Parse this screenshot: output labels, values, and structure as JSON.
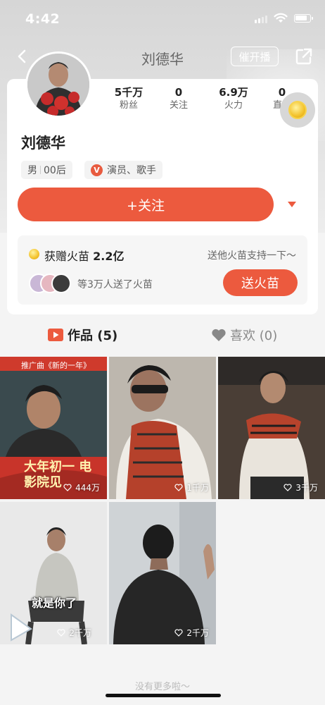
{
  "status_bar": {
    "time": "4:42"
  },
  "nav": {
    "title": "刘德华",
    "urge_label": "催开播"
  },
  "profile": {
    "name": "刘德华",
    "stats": [
      {
        "value": "5千万",
        "label": "粉丝"
      },
      {
        "value": "0",
        "label": "关注"
      },
      {
        "value": "6.9万",
        "label": "火力"
      },
      {
        "value": "0",
        "label": "直播"
      }
    ],
    "gender": "男",
    "age_group": "00后",
    "occupation": "演员、歌手",
    "verified_badge": "V",
    "follow_label": "+关注"
  },
  "gift": {
    "title_prefix": "获赠火苗",
    "amount": "2.2亿",
    "support_text": "送他火苗支持一下～",
    "fans_text": "等3万人送了火苗",
    "send_label": "送火苗"
  },
  "tabs": [
    {
      "label": "作品 (5)",
      "icon": "play-icon"
    },
    {
      "label": "喜欢 (0)",
      "icon": "heart-icon"
    }
  ],
  "videos": [
    {
      "likes": "444万",
      "overlay_title": "大年初一 电影院见",
      "poster_caption": "推广曲《新的一年》"
    },
    {
      "likes": "1千万"
    },
    {
      "likes": "3千万"
    },
    {
      "likes": "2千万",
      "caption": "就是你了"
    },
    {
      "likes": "2千万"
    }
  ],
  "footer": {
    "end_text": "没有更多啦～"
  },
  "colors": {
    "accent": "#ec5a3e",
    "coin": "#f3c22b"
  }
}
